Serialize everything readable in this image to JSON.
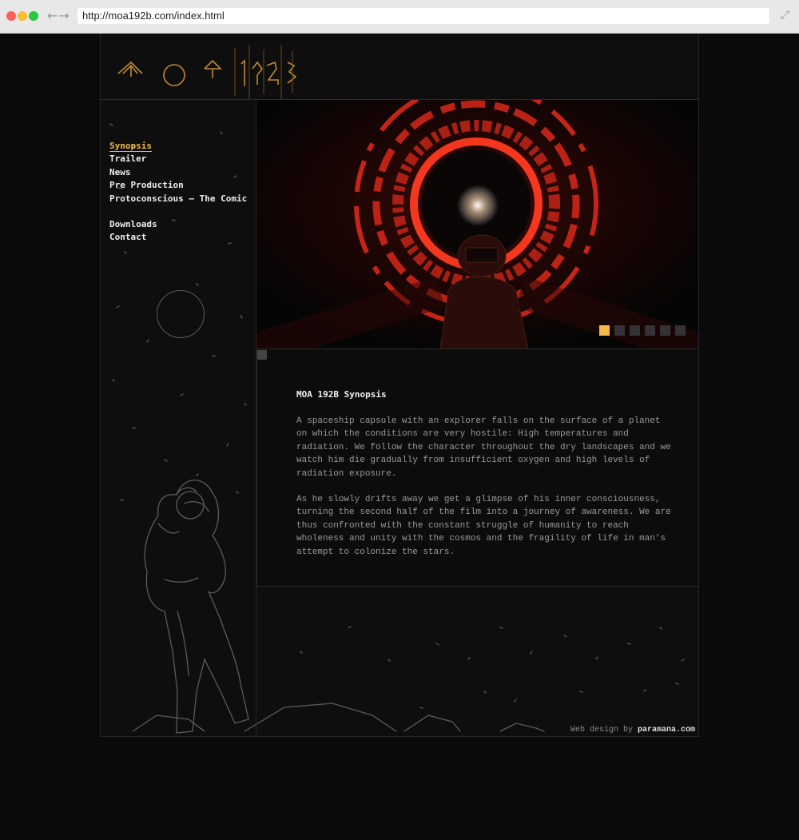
{
  "browser": {
    "url": "http://moa192b.com/index.html",
    "back_icon": "back-arrow-icon",
    "forward_icon": "forward-arrow-icon",
    "expand_icon": "fullscreen-icon"
  },
  "site": {
    "logo_text": "MOA192B",
    "nav": [
      {
        "label": "Synopsis",
        "active": true
      },
      {
        "label": "Trailer"
      },
      {
        "label": "News"
      },
      {
        "label": "Pre Production"
      },
      {
        "label": "Protoconscious — The Comic"
      },
      {
        "label": "Downloads"
      },
      {
        "label": "Contact"
      }
    ],
    "slideshow": {
      "count": 6,
      "active_index": 0
    },
    "synopsis": {
      "title": "MOA 192B Synopsis",
      "paragraph1": "A spaceship capsule with an explorer falls on the surface of a planet on which the conditions are very hostile: High temperatures and radiation. We follow the character throughout the dry landscapes and we watch him die gradually from insufficient oxygen and high levels of radiation exposure.",
      "paragraph2": "As he slowly drifts away we get a glimpse of his inner consciousness, turning the second half of the film into a journey of awareness. We are thus confronted with the constant struggle of humanity to reach wholeness and unity with the cosmos and the fragility of life in man’s attempt to colonize the stars."
    },
    "credit": {
      "prefix": "Web design by ",
      "author": "paramana.com"
    },
    "colors": {
      "accent": "#f4b84a",
      "hero_red": "#e0301e",
      "background": "#0b0b0b"
    }
  }
}
